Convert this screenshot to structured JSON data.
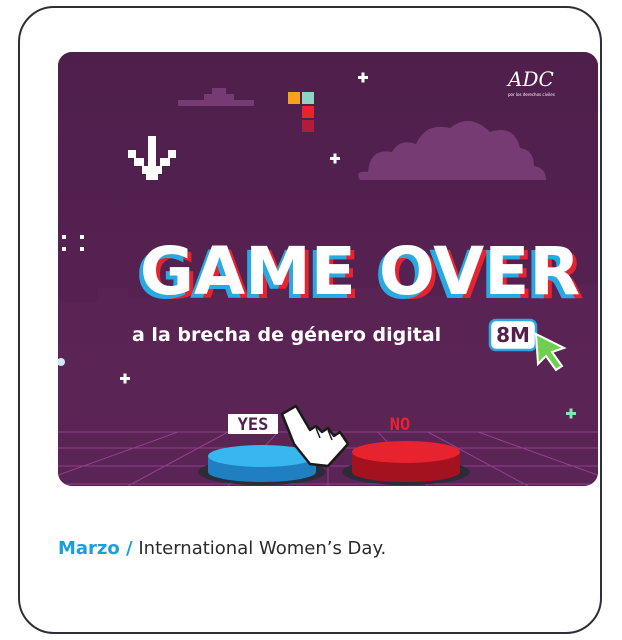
{
  "banner": {
    "logo": "ADC",
    "logo_sub": "por los derechos civiles",
    "headline": "GAME OVER",
    "subline": "a la brecha de género digital",
    "badge": "8M",
    "yes_label": "YES",
    "no_label": "NO"
  },
  "caption": {
    "month": "Marzo /",
    "event": "International Women’s Day."
  },
  "colors": {
    "background": "#53204e",
    "accent_blue": "#29a9e1",
    "accent_red": "#e6232f",
    "caption_month": "#1aa0d8",
    "cursor_green": "#6fd04f"
  },
  "icons": [
    "arrow-down-icon",
    "hand-pointer-icon",
    "mouse-cursor-icon",
    "cloud-icon",
    "plus-icon"
  ]
}
